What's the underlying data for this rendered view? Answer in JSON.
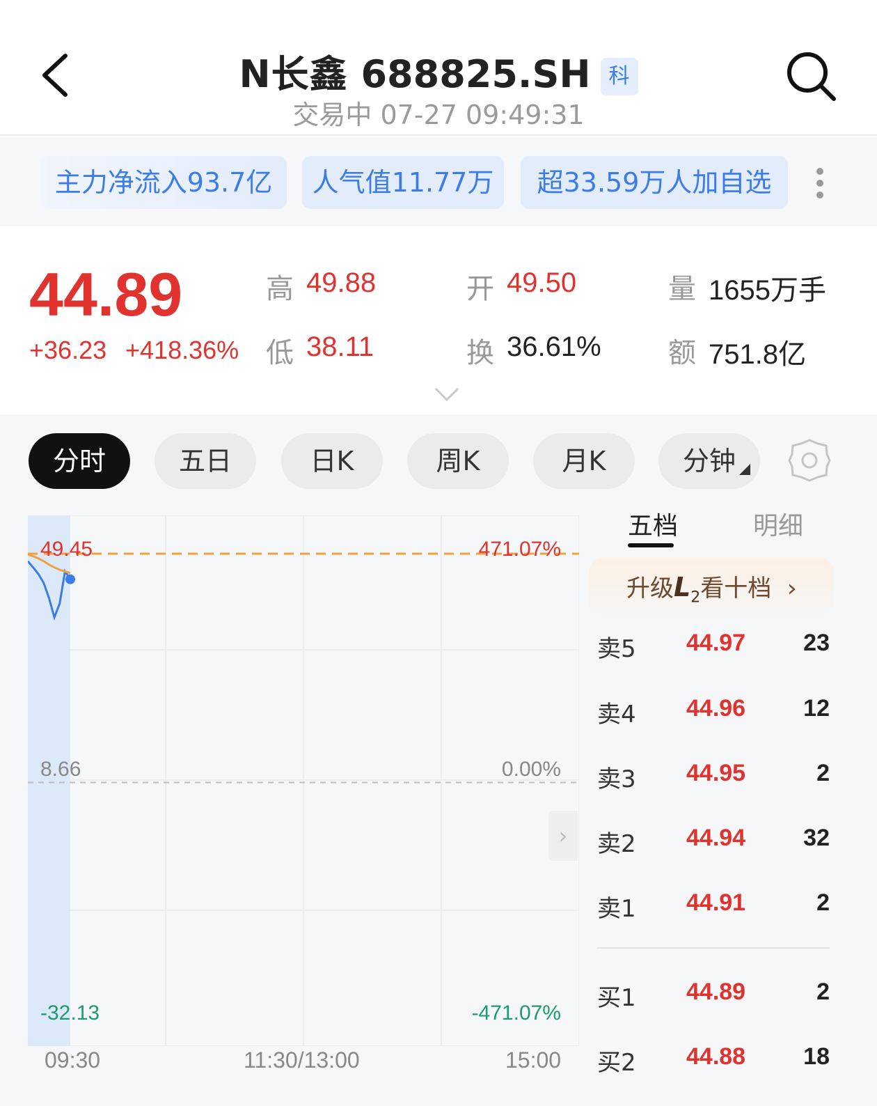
{
  "header": {
    "stock_name": "N长鑫",
    "stock_code": "688825.SH",
    "board_badge": "科",
    "status": "交易中 07-27 09:49:31"
  },
  "tags": [
    {
      "label": "主力净流入93.7亿"
    },
    {
      "label": "人气值11.77万"
    },
    {
      "label": "超33.59万人加自选"
    }
  ],
  "quote": {
    "price": "44.89",
    "change": "+36.23",
    "change_pct": "+418.36%",
    "high_label": "高",
    "high": "49.88",
    "low_label": "低",
    "low": "38.11",
    "open_label": "开",
    "open": "49.50",
    "turnover_label": "换",
    "turnover": "36.61%",
    "volume_label": "量",
    "volume": "1655万手",
    "amount_label": "额",
    "amount": "751.8亿"
  },
  "chart_tabs": [
    "分时",
    "五日",
    "日K",
    "周K",
    "月K",
    "分钟"
  ],
  "chart_data": {
    "type": "line",
    "y_left_labels": [
      "49.45",
      "8.66",
      "-32.13"
    ],
    "y_right_labels": [
      "471.07%",
      "0.00%",
      "-471.07%"
    ],
    "x_labels": [
      "09:30",
      "11:30/13:00",
      "15:00"
    ],
    "ylim": [
      -32.13,
      49.45
    ],
    "series": [
      {
        "color": "#3b7ce8",
        "values": [
          48.1,
          47.0,
          45.8,
          44.2,
          41.5,
          38.1,
          40.6,
          46.3,
          44.89
        ]
      },
      {
        "color": "#f0a040",
        "values": [
          49.3,
          49.0,
          48.6,
          48.1,
          47.5,
          47.0,
          46.6,
          46.3,
          46.0
        ]
      }
    ],
    "limit_line_value": 49.45,
    "baseline_value": 8.66,
    "colors": {
      "up": "#e0322f",
      "down": "#1f9a6e",
      "axis": "#888888",
      "limit": "#f0a040"
    }
  },
  "order_book": {
    "tab_five": "五档",
    "tab_detail": "明细",
    "upgrade": {
      "prefix": "升级",
      "l2": "L",
      "l2_sub": "2",
      "suffix": "看十档"
    },
    "asks": [
      {
        "label": "卖5",
        "price": "44.97",
        "volume": "23"
      },
      {
        "label": "卖4",
        "price": "44.96",
        "volume": "12"
      },
      {
        "label": "卖3",
        "price": "44.95",
        "volume": "2"
      },
      {
        "label": "卖2",
        "price": "44.94",
        "volume": "32"
      },
      {
        "label": "卖1",
        "price": "44.91",
        "volume": "2"
      }
    ],
    "bids": [
      {
        "label": "买1",
        "price": "44.89",
        "volume": "2"
      },
      {
        "label": "买2",
        "price": "44.88",
        "volume": "18"
      }
    ]
  }
}
